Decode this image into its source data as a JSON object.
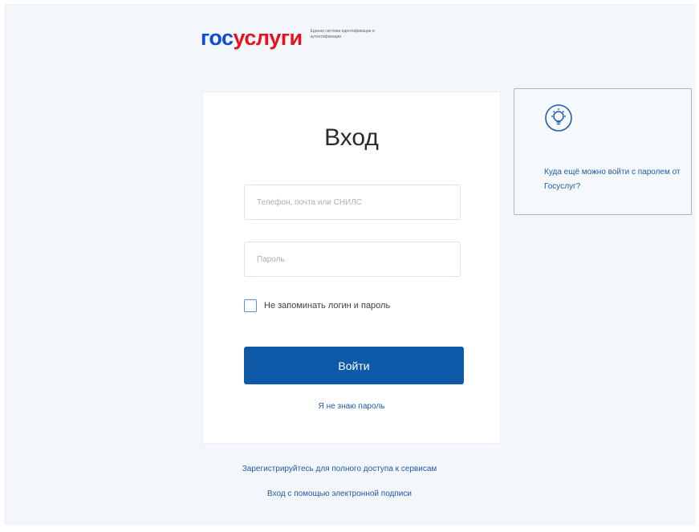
{
  "header": {
    "logo_part1": "гос",
    "logo_part2": "услуги",
    "logo_tagline": "Единая система идентификации и аутентификации"
  },
  "login": {
    "title": "Вход",
    "login_placeholder": "Телефон, почта или СНИЛС",
    "password_placeholder": "Пароль",
    "remember_label": "Не запоминать логин и пароль",
    "submit_label": "Войти",
    "forgot_label": "Я не знаю пароль"
  },
  "hint": {
    "icon": "lightbulb-icon",
    "text": "Куда ещё можно войти с паролем от Госуслуг?"
  },
  "footer": {
    "register_label": "Зарегистрируйтесь для полного доступа к сервисам",
    "esign_label": "Вход с помощью электронной подписи"
  },
  "colors": {
    "brand_blue": "#0d4cd3",
    "brand_red": "#e4131d",
    "button_blue": "#0f5aa8",
    "link_blue": "#1f5ba8",
    "page_bg": "#f3f6fa"
  }
}
